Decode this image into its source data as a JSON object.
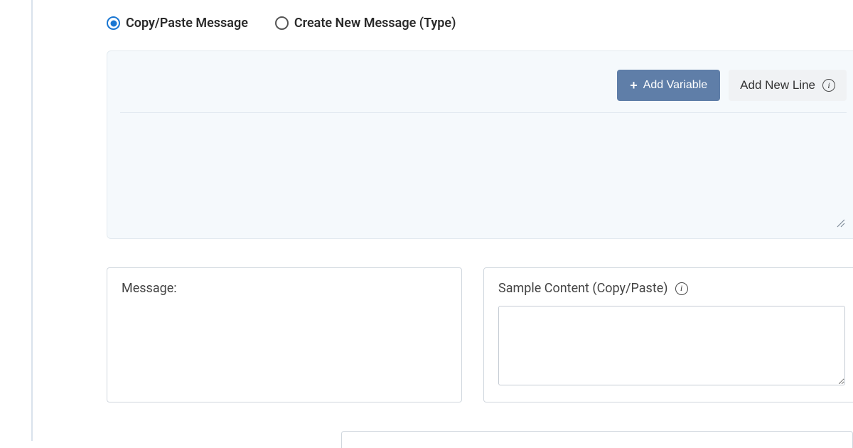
{
  "radios": {
    "copy_paste": "Copy/Paste Message",
    "create_new": "Create New Message (Type)"
  },
  "toolbar": {
    "add_variable": "Add Variable",
    "add_new_line": "Add New Line"
  },
  "panels": {
    "message_label": "Message:",
    "sample_content_label": "Sample Content (Copy/Paste)"
  }
}
